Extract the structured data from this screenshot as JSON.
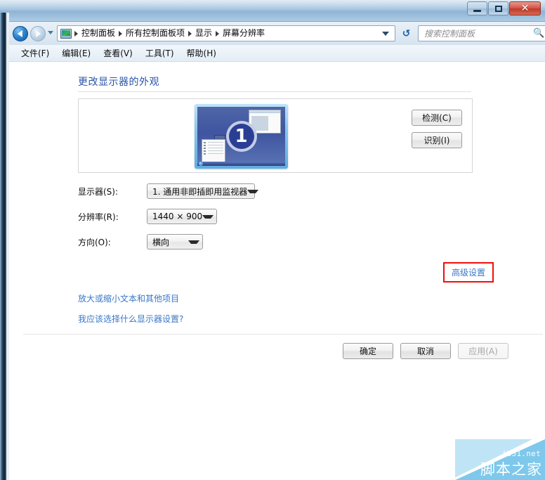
{
  "window": {
    "controls": {
      "minimize_label": "–",
      "maximize_label": "□",
      "close_label": "✕"
    }
  },
  "navbar": {
    "back_icon": "back-arrow-icon",
    "forward_icon": "forward-arrow-icon",
    "history_icon": "history-dropdown-icon",
    "address_icon": "display-monitor-icon",
    "breadcrumbs": [
      "控制面板",
      "所有控制面板项",
      "显示",
      "屏幕分辨率"
    ],
    "dropdown_icon": "chevron-down-icon",
    "refresh_icon": "↺",
    "search": {
      "placeholder": "搜索控制面板",
      "value": "",
      "icon": "🔍"
    }
  },
  "menubar": {
    "items": [
      {
        "label": "文件(F)"
      },
      {
        "label": "编辑(E)"
      },
      {
        "label": "查看(V)"
      },
      {
        "label": "工具(T)"
      },
      {
        "label": "帮助(H)"
      }
    ]
  },
  "main": {
    "page_title": "更改显示器的外观",
    "preview": {
      "monitor_number": "1",
      "detect_button": "检测(C)",
      "identify_button": "识别(I)"
    },
    "form": {
      "monitor": {
        "label": "显示器(S):",
        "value": "1. 通用非即插即用监视器"
      },
      "resolution": {
        "label": "分辨率(R):",
        "value": "1440 × 900"
      },
      "orientation": {
        "label": "方向(O):",
        "value": "横向"
      }
    },
    "advanced_link": "高级设置",
    "links": [
      {
        "label": "放大或缩小文本和其他项目"
      },
      {
        "label": "我应该选择什么显示器设置?"
      }
    ],
    "buttons": {
      "ok": "确定",
      "cancel": "取消",
      "apply": "应用(A)"
    }
  },
  "watermark": {
    "url": "jb51.net",
    "name": "脚本之家"
  },
  "colors": {
    "link_blue": "#3a78c8",
    "title_blue": "#2a54a8",
    "highlight_red": "#f20d0d",
    "badge_blue": "#2a3f93",
    "watermark_blue": "#7ec8ec"
  }
}
